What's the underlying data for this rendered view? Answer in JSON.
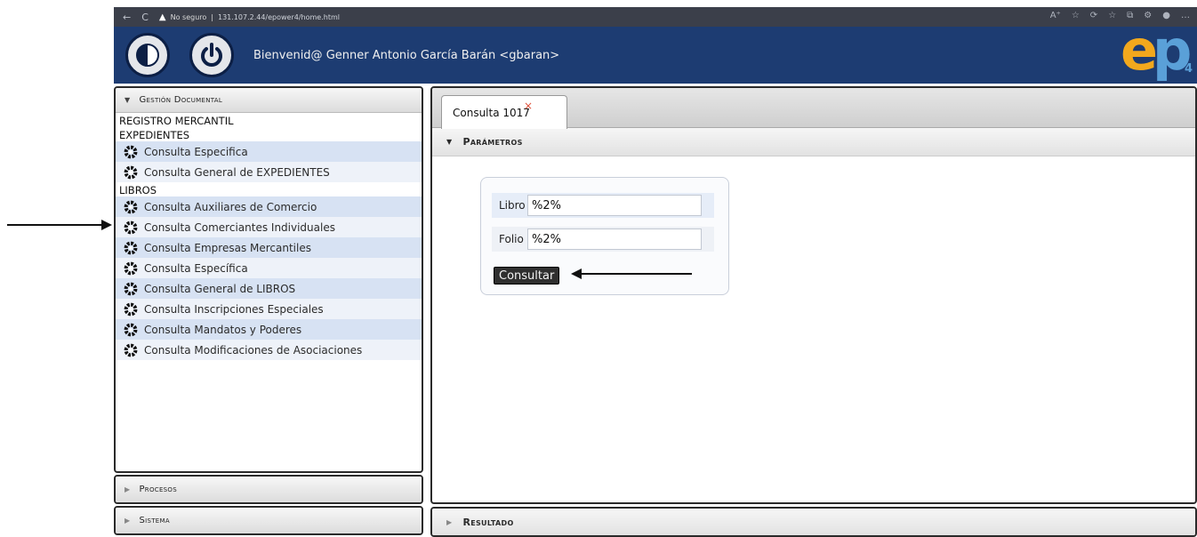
{
  "browser": {
    "nav_back": "←",
    "nav_reload": "C",
    "security_label": "No seguro",
    "url": "131.107.2.44/epower4/home.html",
    "tools": [
      "A⁺",
      "☆",
      "⟳",
      "☆",
      "⧉",
      "⚙",
      "●",
      "…"
    ]
  },
  "header": {
    "welcome_text": "Bienvenid@ Genner Antonio García Barán <gbaran>",
    "logo_text": "ep",
    "logo_suffix": "4"
  },
  "sidebar": {
    "gestion_title": "Gestión Documental",
    "registro_label": "REGISTRO MERCANTIL",
    "expedientes_label": "EXPEDIENTES",
    "expedientes_items": [
      "Consulta Especifica",
      "Consulta General de EXPEDIENTES"
    ],
    "libros_label": "LIBROS",
    "libros_items": [
      "Consulta Auxiliares de Comercio",
      "Consulta Comerciantes Individuales",
      "Consulta Empresas Mercantiles",
      "Consulta Específica",
      "Consulta General de LIBROS",
      "Consulta Inscripciones Especiales",
      "Consulta Mandatos y Poderes",
      "Consulta Modificaciones de Asociaciones"
    ],
    "procesos_title": "Procesos",
    "sistema_title": "Sistema"
  },
  "main": {
    "tab_label": "Consulta 1017",
    "tab_close": "×",
    "parametros_title": "Parámetros",
    "resultado_title": "Resultado",
    "fields": {
      "libro_label": "Libro",
      "libro_value": "%2%",
      "folio_label": "Folio",
      "folio_value": "%2%"
    },
    "consultar_label": "Consultar"
  },
  "colors": {
    "header_bg": "#1d3c72",
    "menu_stripe": "#d7e2f3",
    "logo_orange": "#f2a81d",
    "logo_blue": "#5aa0d8"
  }
}
